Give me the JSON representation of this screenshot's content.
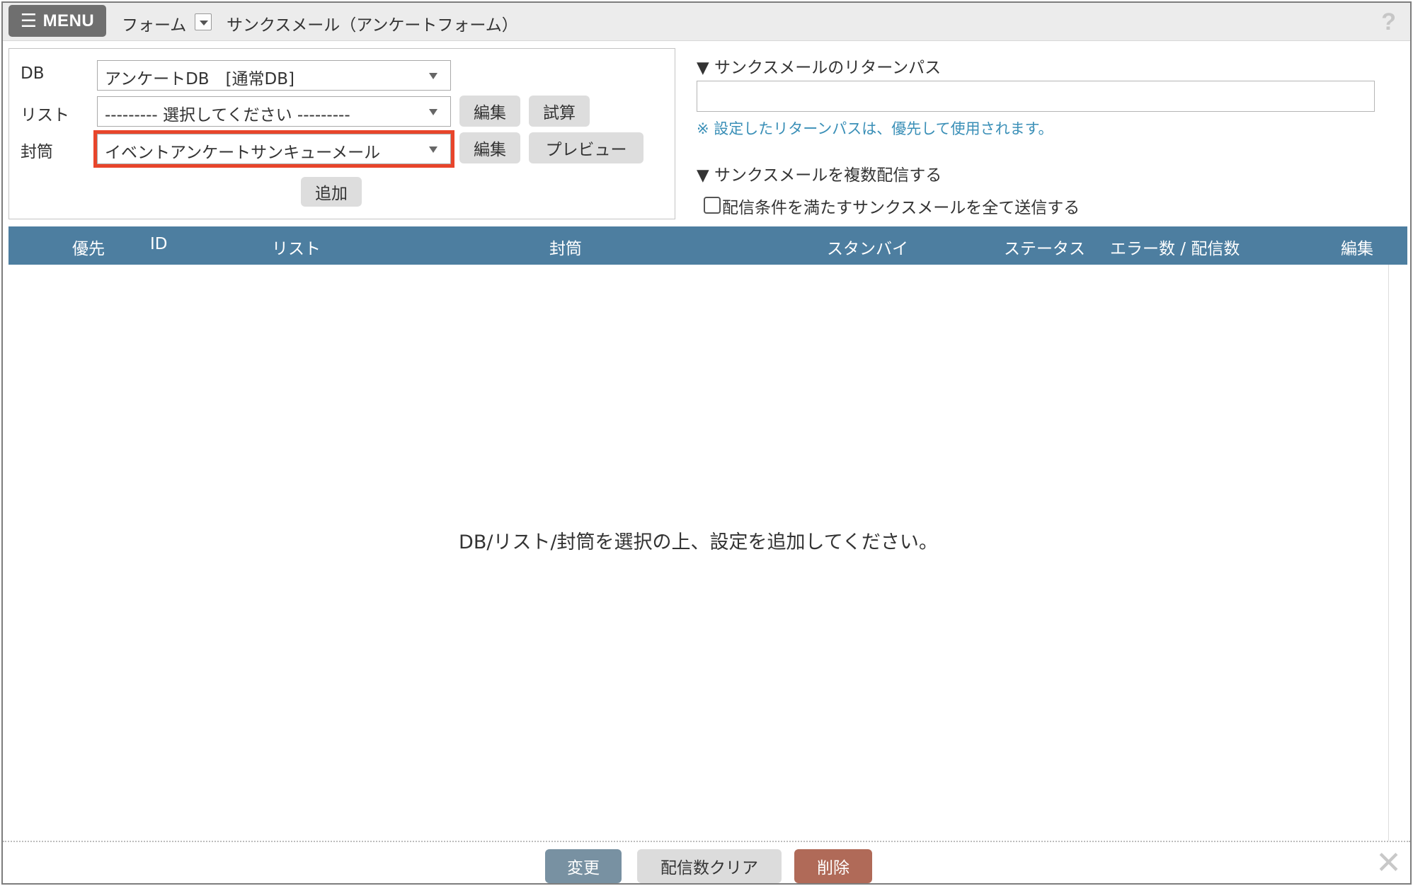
{
  "topbar": {
    "menu_label": "MENU",
    "crumb_form": "フォーム",
    "title": "サンクスメール（アンケートフォーム）",
    "help": "?"
  },
  "settings": {
    "db": {
      "label": "DB",
      "value": "アンケートDB　[通常DB]"
    },
    "list": {
      "label": "リスト",
      "value": "--------- 選択してください ---------",
      "edit": "編集",
      "test": "試算"
    },
    "envelope": {
      "label": "封筒",
      "value": "イベントアンケートサンキューメール",
      "edit": "編集",
      "preview": "プレビュー"
    },
    "add": "追加"
  },
  "return_path": {
    "heading": "▼ サンクスメールのリターンパス",
    "value": "",
    "note": "※ 設定したリターンパスは、優先して使用されます。"
  },
  "multi": {
    "heading": "▼ サンクスメールを複数配信する",
    "checkbox_label": "配信条件を満たすサンクスメールを全て送信する",
    "checked": false
  },
  "table": {
    "headers": {
      "priority": "優先",
      "id": "ID",
      "list": "リスト",
      "envelope": "封筒",
      "standby": "スタンバイ",
      "status": "ステータス",
      "errors": "エラー数 / 配信数",
      "edit": "編集"
    },
    "empty_message": "DB/リスト/封筒を選択の上、設定を追加してください。"
  },
  "footer": {
    "change": "変更",
    "clear": "配信数クリア",
    "delete": "削除",
    "close": "✕"
  },
  "colors": {
    "table_header": "#4d7ea0",
    "highlight": "#e8452b",
    "note": "#3a8fb7",
    "change_button": "#7891a2",
    "delete_button": "#b06a58"
  }
}
